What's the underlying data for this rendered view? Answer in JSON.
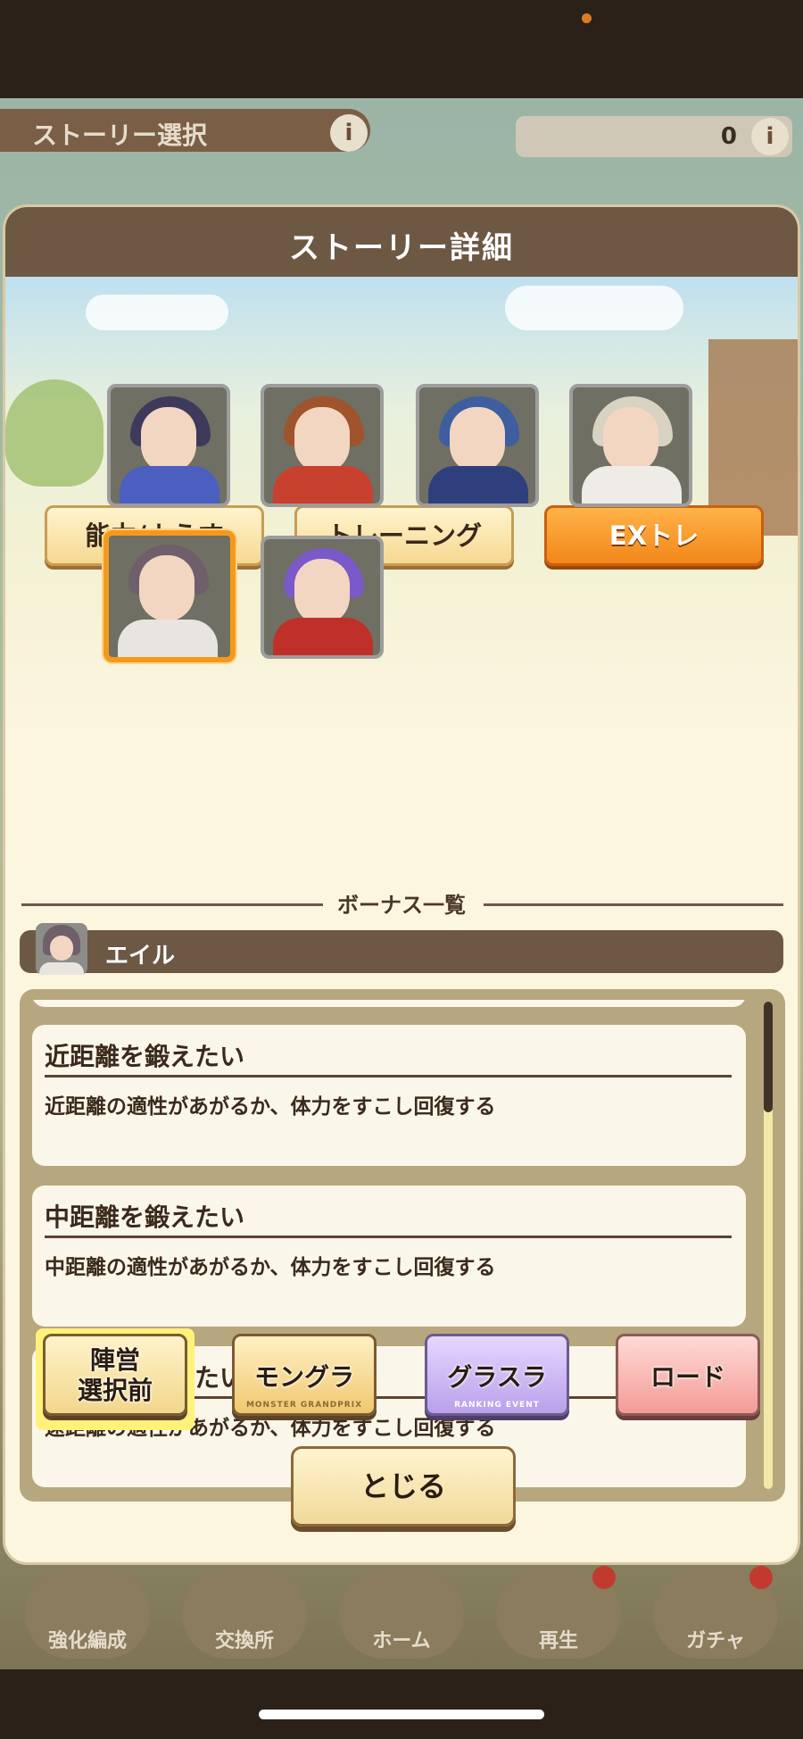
{
  "background": {
    "header_title": "ストーリー選択",
    "info_icon": "i",
    "currency_value": "0",
    "nav": [
      "強化編成",
      "交換所",
      "ホーム",
      "再生",
      "ガチャ"
    ]
  },
  "modal": {
    "title": "ストーリー詳細",
    "tabs": [
      {
        "label": "能力/ようす",
        "active": false
      },
      {
        "label": "トレーニング",
        "active": false
      },
      {
        "label": "EXトレ",
        "active": true
      }
    ],
    "section_label": "ボーナス一覧",
    "selected_character": "エイル",
    "bonuses": [
      {
        "title": "近距離を鍛えたい",
        "desc": "近距離の適性があがるか、体力をすこし回復する"
      },
      {
        "title": "中距離を鍛えたい",
        "desc": "中距離の適性があがるか、体力をすこし回復する"
      },
      {
        "title": "遠距離を鍛えたい",
        "desc": "遠距離の適性があがるか、体力をすこし回復する"
      }
    ],
    "modes": [
      {
        "label": "陣営\n選択前",
        "sub": ""
      },
      {
        "label": "モングラ",
        "sub": "MONSTER GRANDPRIX"
      },
      {
        "label": "グラスラ",
        "sub": "RANKING EVENT"
      },
      {
        "label": "ロード",
        "sub": ""
      }
    ],
    "close_label": "とじる"
  },
  "colors": {
    "accent_orange": "#f2871a",
    "header_brown": "#6d5844",
    "panel_cream": "#fdf6df"
  }
}
